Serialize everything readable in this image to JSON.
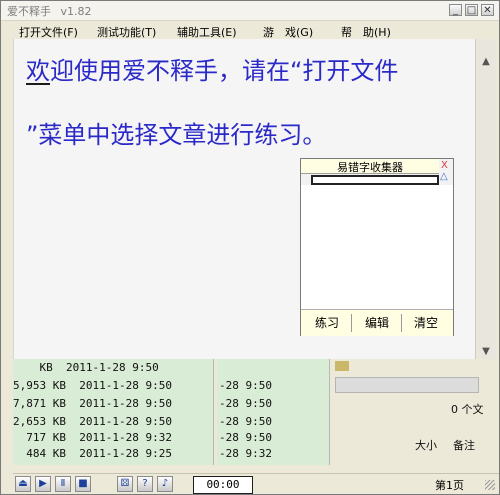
{
  "window": {
    "title": "爱不释手",
    "version": "v1.82"
  },
  "menu": {
    "items": [
      "打开文件(F)",
      "测试功能(T)",
      "辅助工具(E)",
      "游　戏(G)",
      "帮　助(H)"
    ]
  },
  "document": {
    "line1": "欢迎使用爱不释手，请在“打开文件",
    "line2": "”菜单中选择文章进行练习。"
  },
  "collector": {
    "title": "易错字收集器",
    "buttons": [
      "练习",
      "编辑",
      "清空"
    ]
  },
  "panes": {
    "left_rows": [
      "    KB  2011-1-28 9:50",
      "5,953 KB  2011-1-28 9:50",
      "7,871 KB  2011-1-28 9:50",
      "2,653 KB  2011-1-28 9:50",
      "  717 KB  2011-1-28 9:32",
      "  484 KB  2011-1-28 9:25"
    ],
    "mid_rows": [
      "-28 9:50",
      "-28 9:50",
      "-28 9:50",
      "-28 9:50",
      "-28 9:32",
      "-28 9:25"
    ],
    "right": {
      "status": "0 个文",
      "col_size": "大小",
      "col_note": "备注"
    }
  },
  "toolbar": {
    "timer": "00:00",
    "page": "第1页"
  }
}
